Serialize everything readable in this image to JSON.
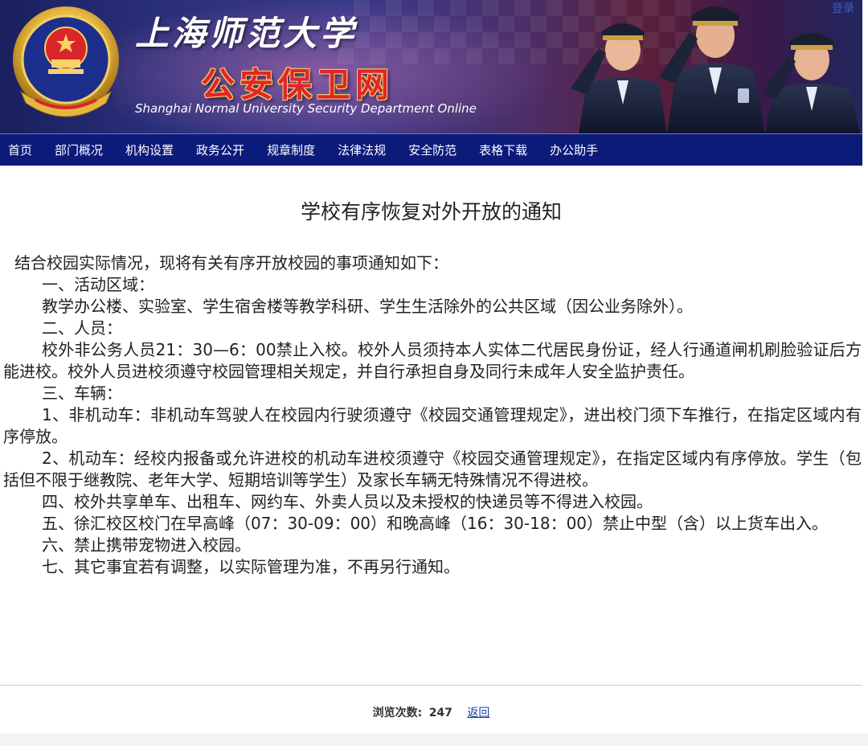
{
  "banner": {
    "title_cn_line1": "上海师范大学",
    "title_cn_line2": "公安保卫网",
    "title_en": "Shanghai Normal University Security Department Online",
    "login_label": "登录",
    "emblem_icon": "national-emblem-icon",
    "officers_image": "saluting-officers-image"
  },
  "nav": {
    "items": [
      {
        "label": "首页"
      },
      {
        "label": "部门概况"
      },
      {
        "label": "机构设置"
      },
      {
        "label": "政务公开"
      },
      {
        "label": "规章制度"
      },
      {
        "label": "法律法规"
      },
      {
        "label": "安全防范"
      },
      {
        "label": "表格下载"
      },
      {
        "label": "办公助手"
      }
    ]
  },
  "article": {
    "title": "学校有序恢复对外开放的通知",
    "paragraphs": [
      "结合校园实际情况，现将有关有序开放校园的事项通知如下：",
      "一、活动区域：",
      "教学办公楼、实验室、学生宿舍楼等教学科研、学生生活除外的公共区域（因公业务除外）。",
      "二、人员：",
      "校外非公务人员21：30—6：00禁止入校。校外人员须持本人实体二代居民身份证，经人行通道闸机刷脸验证后方能进校。校外人员进校须遵守校园管理相关规定，并自行承担自身及同行未成年人安全监护责任。",
      "三、车辆：",
      "1、非机动车：非机动车驾驶人在校园内行驶须遵守《校园交通管理规定》，进出校门须下车推行，在指定区域内有序停放。",
      "2、机动车：经校内报备或允许进校的机动车进校须遵守《校园交通管理规定》，在指定区域内有序停放。学生（包括但不限于继教院、老年大学、短期培训等学生）及家长车辆无特殊情况不得进校。",
      "四、校外共享单车、出租车、网约车、外卖人员以及未授权的快递员等不得进入校园。",
      "五、徐汇校区校门在早高峰（07：30-09：00）和晚高峰（16：30-18：00）禁止中型（含）以上货车出入。",
      "六、禁止携带宠物进入校园。",
      "七、其它事宜若有调整，以实际管理为准，不再另行通知。"
    ]
  },
  "footer": {
    "views_label": "浏览次数:",
    "views_count": "247",
    "back_label": "返回"
  },
  "colors": {
    "nav_bg": "#0c1a7a",
    "title_red": "#e0262a",
    "link_blue": "#1a3aa0"
  }
}
